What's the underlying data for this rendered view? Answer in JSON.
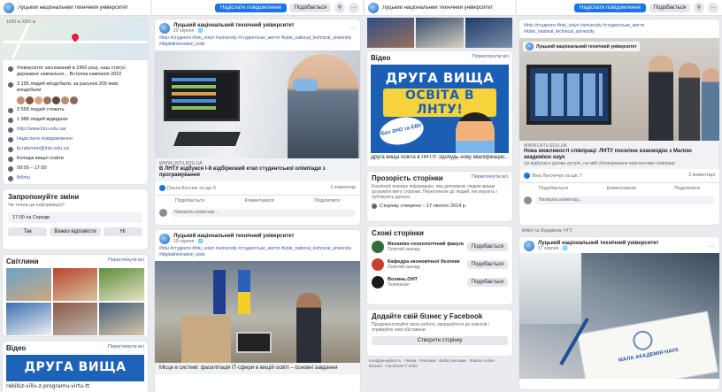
{
  "page_name": "Луцький національний технічний університет",
  "header": {
    "messenger": "Надіслати повідомлення",
    "subscribe": "Подобається",
    "search_icon": "search-icon",
    "more": "···"
  },
  "col1": {
    "map_note": "1000 м 2000 м",
    "about": [
      "Університет заснований в 1966 році, наш статус: державне навчальне... Вступна кампанія 2022",
      "3 195 людей вподобали, за рахунок 300 яких вподобали",
      "3 558 людей стежать",
      "1 988 людей відвідали",
      "http://www.lntu.edu.ua/",
      "Надіслати повідомлення",
      "lp.ratumen@lntu.edu.ua",
      "Коледж вищої освіти",
      "09:00 – 17:00"
    ],
    "rate": "Рейтинг",
    "fb_label": "fb/lntu",
    "question": {
      "title": "Запропонуйте зміни",
      "sub": "Чи точна ця інформація?",
      "hours": "17:00 на Середи",
      "yes": "Так",
      "no_info": "Важко відповісти",
      "no": "Ні"
    },
    "photos": {
      "title": "Світлини",
      "see_all": "Переглянути всі"
    },
    "video": {
      "title": "Відео",
      "see_all": "Переглянути всі",
      "banner": "ДРУГА ВИЩА",
      "caption": "rebibiz-villu-z-programu-virtu-tt"
    }
  },
  "col2": {
    "post1": {
      "author": "Луцький національний технічний університет",
      "time": "20 серпня · 🌐",
      "tags": "#lntu #студенти #lntu_volyn #university #студентське_життя #lutsk_national_technical_university #digitalinnovation_lutsk",
      "link_domain": "WWW.LNTU.EDU.UA",
      "link_title": "В ЛНТУ відбувся І-й відбірковий етап студентської олімпіади з програмування",
      "reactions": "Ольга Костюк та ще 5",
      "comments": "1 коментар",
      "like": "Подобається",
      "comment": "Коментувати",
      "share": "Поділитися",
      "write": "Напишіть коментар..."
    },
    "post2": {
      "author": "Луцький національний технічний університет",
      "time": "19 серпня · 🌐",
      "tags": "#lntu #студенти #lntu_volyn #university #студентське_життя #lutsk_national_technical_university #digitalinnovation_lutsk",
      "caption": "Місце в системі: фасилітація ІТ-сфери в вищій освіті – основні завдання"
    }
  },
  "col3": {
    "video": {
      "title": "Відео",
      "see_all": "Переглянути всі",
      "banner1": "ДРУГА ВИЩА",
      "banner2": "ОСВІТА В ЛНТУ!",
      "badge": "Без ЗНО та ЄВІ!",
      "caption": "Друга вища освіта в ЛНТУ! Здобудь нову кваліфікацію..."
    },
    "transparency": {
      "title": "Прозорість сторінки",
      "see_all": "Переглянути всі",
      "text": "Facebook показує інформацію, яка допомагає людям краще зрозуміти мету сторінки. Перегляньте дії людей, які керують і публікують дописи.",
      "created": "Сторінку створено – 17 лютого 2014 р."
    },
    "similar": {
      "title": "Схожі сторінки",
      "pages": [
        {
          "name": "Механіко-технологічний факультет",
          "sub": "Освітній заклад",
          "btn": "Подобається"
        },
        {
          "name": "Кафедра економічної безпеки",
          "sub": "Освітній заклад",
          "btn": "Подобається"
        },
        {
          "name": "Волинь.ОНТ",
          "sub": "Телеканал",
          "btn": "Подобається"
        }
      ]
    },
    "business": {
      "title": "Додайте свій бізнес у Facebook",
      "text": "Продемонструйте свою роботу, звершуйтеся до клієнтів і отримуйте нові обставини.",
      "cta": "Створити сторінку"
    },
    "footer": "Конфіденційність · Умови · Реклама · Вибір реклами · Файли cookie · Більше · Facebook © 2022"
  },
  "col4": {
    "post1": {
      "author": "Луцький національний технічний університет",
      "time": "20 серпня · 🌐",
      "tags": "#lntu #студенти #lntu_volyn #university #студентське_життя #lutsk_national_technical_university",
      "link_domain": "WWW.LNTU.EDU.UA",
      "link_title": "Нова можливості співпраці: ЛНТУ посилює взаємодію з Малою академією наук",
      "link_sub": "Ця відбулася ділова зустріч, на якій обговорювали перспективи співпраці",
      "reactions": "Ліна Лук'янчук та ще 7",
      "comments": "2 коментарі",
      "like": "Подобається",
      "comment": "Коментувати",
      "share": "Поділитися",
      "write": "Напишіть коментар..."
    },
    "tag_line": "МАН та Людмила ЧТУ",
    "post2": {
      "author": "Луцький національний технічний університет",
      "time": "17 серпня · 🌐",
      "doc": "МАЛА АКАДЕМІЯ НАУК"
    }
  }
}
